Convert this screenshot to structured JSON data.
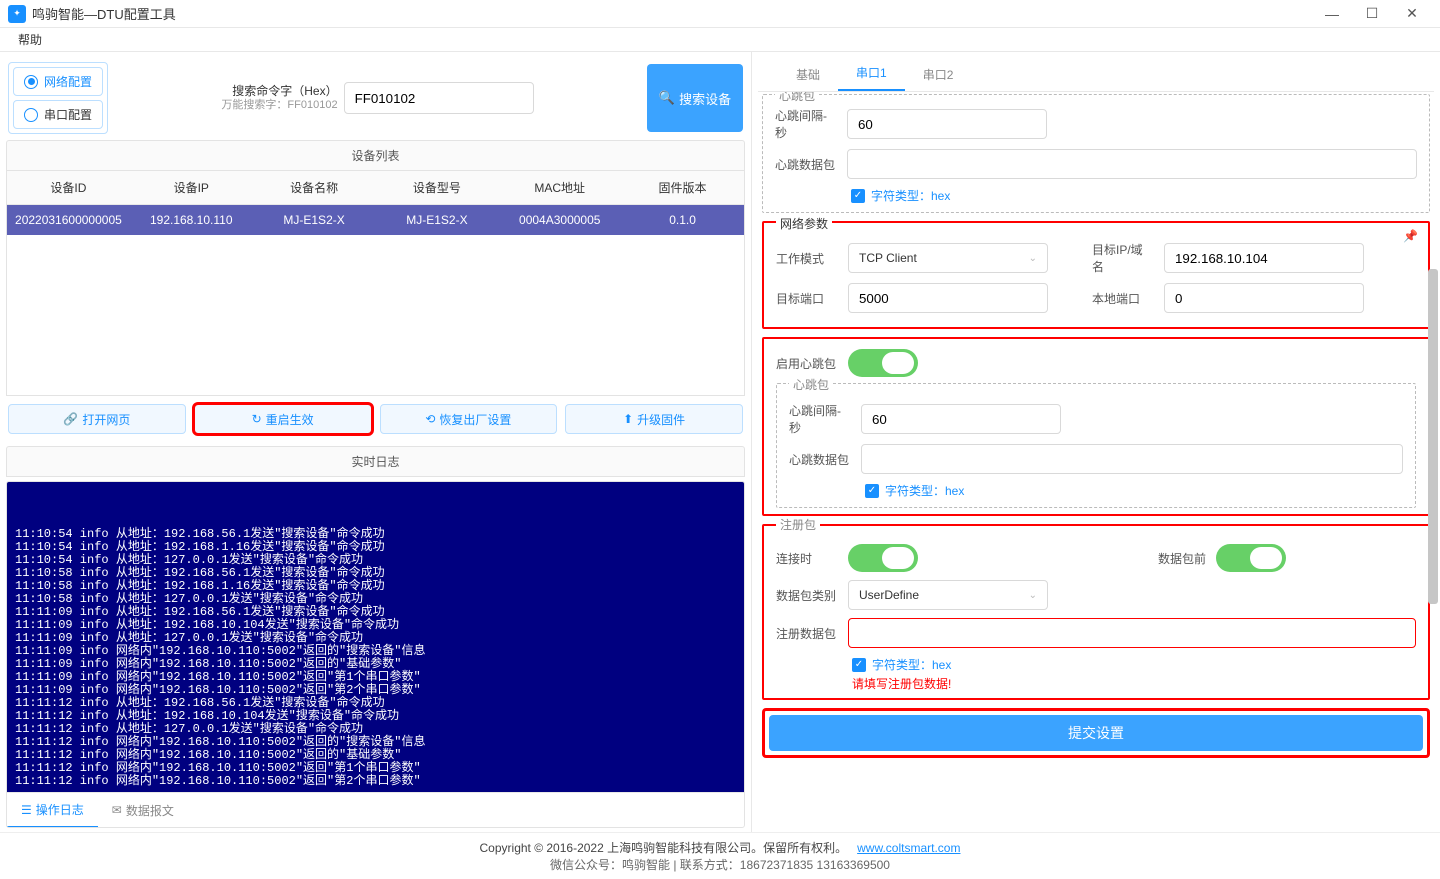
{
  "title": "鸣驹智能—DTU配置工具",
  "menu": {
    "help": "帮助"
  },
  "search": {
    "radio_net": "网络配置",
    "radio_serial": "串口配置",
    "label": "搜索命令字（Hex）",
    "sublabel": "万能搜索字：FF010102",
    "value": "FF010102",
    "button": "搜索设备"
  },
  "device_list": {
    "title": "设备列表",
    "headers": [
      "设备ID",
      "设备IP",
      "设备名称",
      "设备型号",
      "MAC地址",
      "固件版本"
    ],
    "rows": [
      {
        "id": "2022031600000005",
        "ip": "192.168.10.110",
        "name": "MJ-E1S2-X",
        "model": "MJ-E1S2-X",
        "mac": "0004A3000005",
        "fw": "0.1.0"
      }
    ]
  },
  "actions": {
    "open_web": "打开网页",
    "restart": "重启生效",
    "factory": "恢复出厂设置",
    "upgrade": "升级固件"
  },
  "log": {
    "title": "实时日志",
    "tab_op": "操作日志",
    "tab_data": "数据报文",
    "lines": [
      "11:10:54 info 从地址：192.168.56.1发送\"搜索设备\"命令成功",
      "11:10:54 info 从地址：192.168.1.16发送\"搜索设备\"命令成功",
      "11:10:54 info 从地址：127.0.0.1发送\"搜索设备\"命令成功",
      "11:10:58 info 从地址：192.168.56.1发送\"搜索设备\"命令成功",
      "11:10:58 info 从地址：192.168.1.16发送\"搜索设备\"命令成功",
      "11:10:58 info 从地址：127.0.0.1发送\"搜索设备\"命令成功",
      "11:11:09 info 从地址：192.168.56.1发送\"搜索设备\"命令成功",
      "11:11:09 info 从地址：192.168.10.104发送\"搜索设备\"命令成功",
      "11:11:09 info 从地址：127.0.0.1发送\"搜索设备\"命令成功",
      "11:11:09 info 网络内\"192.168.10.110:5002\"返回的\"搜索设备\"信息",
      "11:11:09 info 网络内\"192.168.10.110:5002\"返回的\"基础参数\"",
      "11:11:09 info 网络内\"192.168.10.110:5002\"返回\"第1个串口参数\"",
      "11:11:09 info 网络内\"192.168.10.110:5002\"返回\"第2个串口参数\"",
      "11:11:12 info 从地址：192.168.56.1发送\"搜索设备\"命令成功",
      "11:11:12 info 从地址：192.168.10.104发送\"搜索设备\"命令成功",
      "11:11:12 info 从地址：127.0.0.1发送\"搜索设备\"命令成功",
      "11:11:12 info 网络内\"192.168.10.110:5002\"返回的\"搜索设备\"信息",
      "11:11:12 info 网络内\"192.168.10.110:5002\"返回的\"基础参数\"",
      "11:11:12 info 网络内\"192.168.10.110:5002\"返回\"第1个串口参数\"",
      "11:11:12 info 网络内\"192.168.10.110:5002\"返回\"第2个串口参数\""
    ]
  },
  "right_tabs": {
    "basic": "基础",
    "port1": "串口1",
    "port2": "串口2"
  },
  "heartbeat_top": {
    "legend": "心跳包",
    "interval_label": "心跳间隔-秒",
    "interval": "60",
    "data_label": "心跳数据包",
    "data": "",
    "hex_label": "字符类型：hex"
  },
  "net_params": {
    "legend": "网络参数",
    "mode_label": "工作模式",
    "mode": "TCP Client",
    "target_ip_label": "目标IP/域名",
    "target_ip": "192.168.10.104",
    "target_port_label": "目标端口",
    "target_port": "5000",
    "local_port_label": "本地端口",
    "local_port": "0"
  },
  "heartbeat_enable": {
    "label": "启用心跳包"
  },
  "heartbeat_mid": {
    "legend": "心跳包",
    "interval_label": "心跳间隔-秒",
    "interval": "60",
    "data_label": "心跳数据包",
    "data": "",
    "hex_label": "字符类型：hex"
  },
  "register": {
    "legend": "注册包",
    "connect_label": "连接时",
    "before_label": "数据包前",
    "pkg_type_label": "数据包类别",
    "pkg_type": "UserDefine",
    "pkg_data_label": "注册数据包",
    "hex_label": "字符类型：hex",
    "error": "请填写注册包数据!"
  },
  "submit": "提交设置",
  "footer": {
    "copyright": "Copyright © 2016-2022 上海鸣驹智能科技有限公司。保留所有权利。",
    "link": "www.coltsmart.com",
    "sub": "微信公众号：鸣驹智能 | 联系方式：18672371835 13163369500"
  }
}
